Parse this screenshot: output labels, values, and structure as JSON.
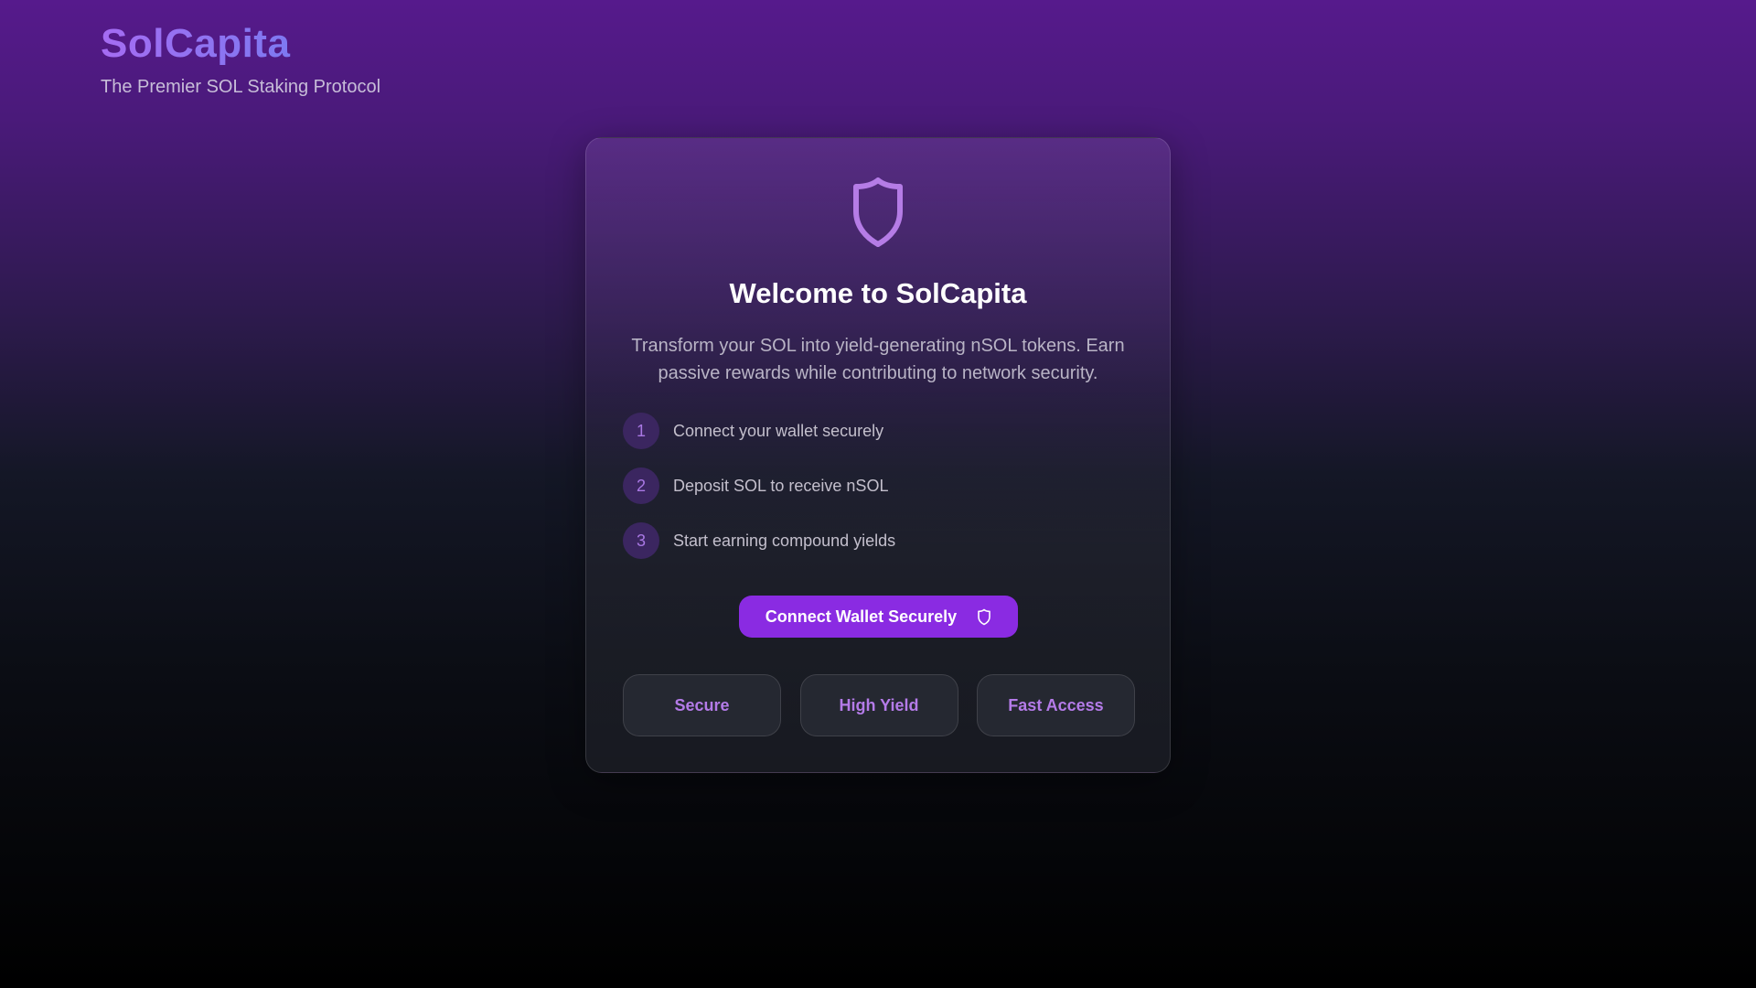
{
  "brand": {
    "title": "SolCapita",
    "subtitle": "The Premier SOL Staking Protocol"
  },
  "card": {
    "icon": "shield-icon",
    "title": "Welcome to SolCapita",
    "description": "Transform your SOL into yield-generating nSOL tokens. Earn passive rewards while contributing to network security.",
    "steps": [
      {
        "number": "1",
        "label": "Connect your wallet securely"
      },
      {
        "number": "2",
        "label": "Deposit SOL to receive nSOL"
      },
      {
        "number": "3",
        "label": "Start earning compound yields"
      }
    ],
    "connect_button": {
      "label": "Connect Wallet Securely",
      "icon": "shield-icon"
    },
    "features": [
      {
        "label": "Secure"
      },
      {
        "label": "High Yield"
      },
      {
        "label": "Fast Access"
      }
    ]
  },
  "colors": {
    "accent": "#8a2be2",
    "accent_light": "#b47be8",
    "brand_gradient_start": "#a56cf2",
    "brand_gradient_end": "#6b7ff0"
  }
}
